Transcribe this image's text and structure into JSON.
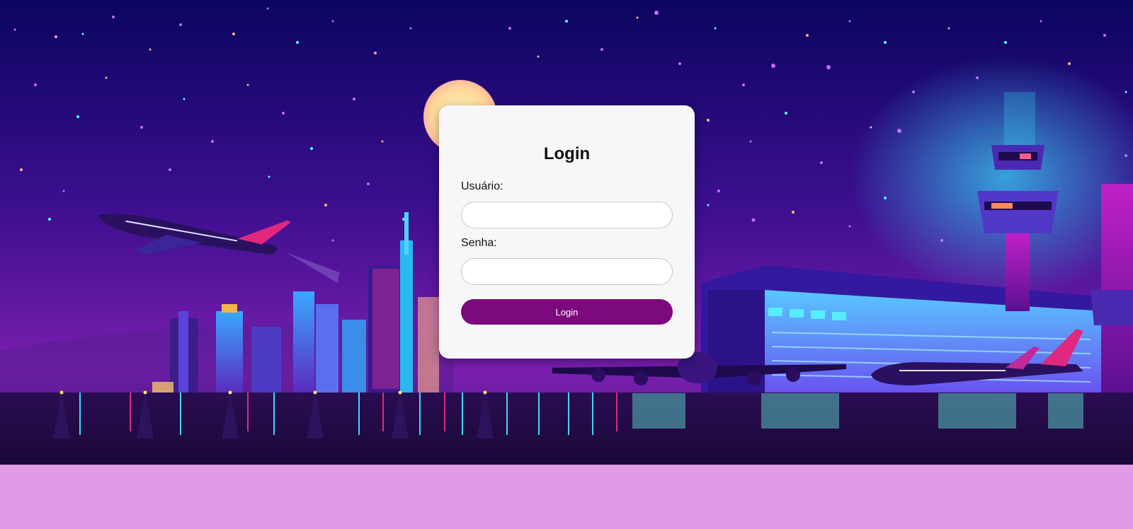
{
  "login": {
    "title": "Login",
    "username_label": "Usuário:",
    "username_value": "",
    "password_label": "Senha:",
    "password_value": "",
    "submit_label": "Login"
  },
  "colors": {
    "button": "#7c0a7e",
    "page_background": "#e19be6",
    "sky_top": "#0a0560",
    "sky_bottom": "#7a1fb0",
    "ground": "#1e0a3c"
  },
  "scene": {
    "description_icons": [
      "moon-icon",
      "airplane-icon",
      "control-tower-icon",
      "city-skyline-icon"
    ]
  }
}
